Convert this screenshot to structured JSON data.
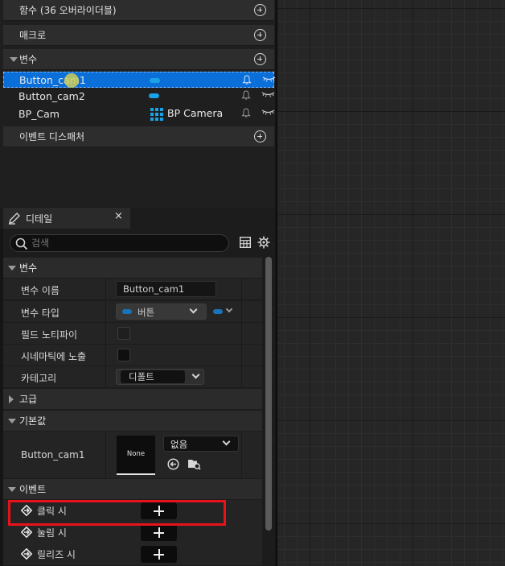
{
  "my_blueprint": {
    "sections": {
      "functions": "함수 (36 오버라이더블)",
      "macros": "매크로",
      "variables": "변수",
      "event_dispatchers": "이벤트 디스패처"
    },
    "variables": [
      {
        "name": "Button_cam1",
        "type": ""
      },
      {
        "name": "Button_cam2",
        "type": ""
      },
      {
        "name": "BP_Cam",
        "type": "BP Camera"
      }
    ]
  },
  "details": {
    "tab_label": "디테일",
    "tab_close": "×",
    "search_placeholder": "검색",
    "variable_section": {
      "title": "변수",
      "var_name_label": "변수 이름",
      "var_name_value": "Button_cam1",
      "var_type_label": "변수 타입",
      "var_type_value": "버튼",
      "replication_label": "필드 노티파이",
      "expose_cinematic_label": "시네마틱에 노출",
      "category_label": "카테고리",
      "category_value": "디폴트"
    },
    "advanced_title": "고급",
    "default_section": {
      "title": "기본값",
      "row_label": "Button_cam1",
      "thumbnail_text": "None",
      "dropdown_value": "없음"
    },
    "events_section": {
      "title": "이벤트",
      "events": [
        "클릭 시",
        "눌림 시",
        "릴리즈 시"
      ]
    }
  },
  "colors": {
    "selection": "#0b6fd9",
    "var_pill": "#1aa1e6",
    "highlight": "#e8121b"
  }
}
